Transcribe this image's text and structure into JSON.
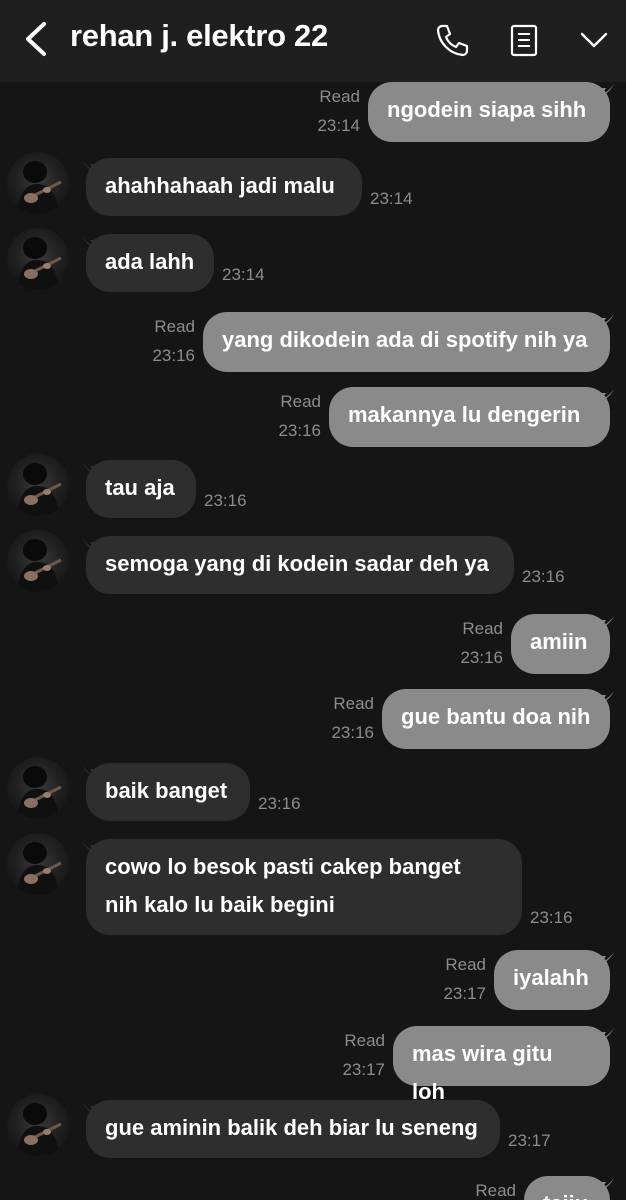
{
  "header": {
    "title": "rehan j. elektro 22",
    "icons": [
      "back-chevron-icon",
      "phone-icon",
      "notes-icon",
      "chevron-down-icon"
    ]
  },
  "colors": {
    "outgoing_bubble": "#8a8a8a",
    "incoming_bubble": "#2e2e2e",
    "background": "#151515",
    "header": "#1f1f1f"
  },
  "messages": [
    {
      "dir": "out",
      "text": "ngodein siapa sihh",
      "time": "23:14",
      "status": "Read"
    },
    {
      "dir": "in",
      "text": "ahahhahaah jadi malu",
      "time": "23:14"
    },
    {
      "dir": "in",
      "text": "ada lahh",
      "time": "23:14"
    },
    {
      "dir": "out",
      "text": "yang dikodein ada di spotify nih ya",
      "time": "23:16",
      "status": "Read"
    },
    {
      "dir": "out",
      "text": "makannya lu dengerin",
      "time": "23:16",
      "status": "Read"
    },
    {
      "dir": "in",
      "text": "tau aja",
      "time": "23:16"
    },
    {
      "dir": "in",
      "text": "semoga yang di kodein sadar deh ya",
      "time": "23:16"
    },
    {
      "dir": "out",
      "text": "amiin",
      "time": "23:16",
      "status": "Read"
    },
    {
      "dir": "out",
      "text": "gue bantu doa nih",
      "time": "23:16",
      "status": "Read"
    },
    {
      "dir": "in",
      "text": "baik banget",
      "time": "23:16"
    },
    {
      "dir": "in",
      "text": "cowo lo besok pasti cakep banget\nnih kalo lu baik begini",
      "time": "23:16"
    },
    {
      "dir": "out",
      "text": "iyalahh",
      "time": "23:17",
      "status": "Read"
    },
    {
      "dir": "out",
      "text": "mas wira gitu loh",
      "time": "23:17",
      "status": "Read"
    },
    {
      "dir": "in",
      "text": "gue aminin balik deh biar lu seneng",
      "time": "23:17"
    },
    {
      "dir": "out",
      "text": "taiiu",
      "time": "",
      "status": "Read"
    }
  ]
}
